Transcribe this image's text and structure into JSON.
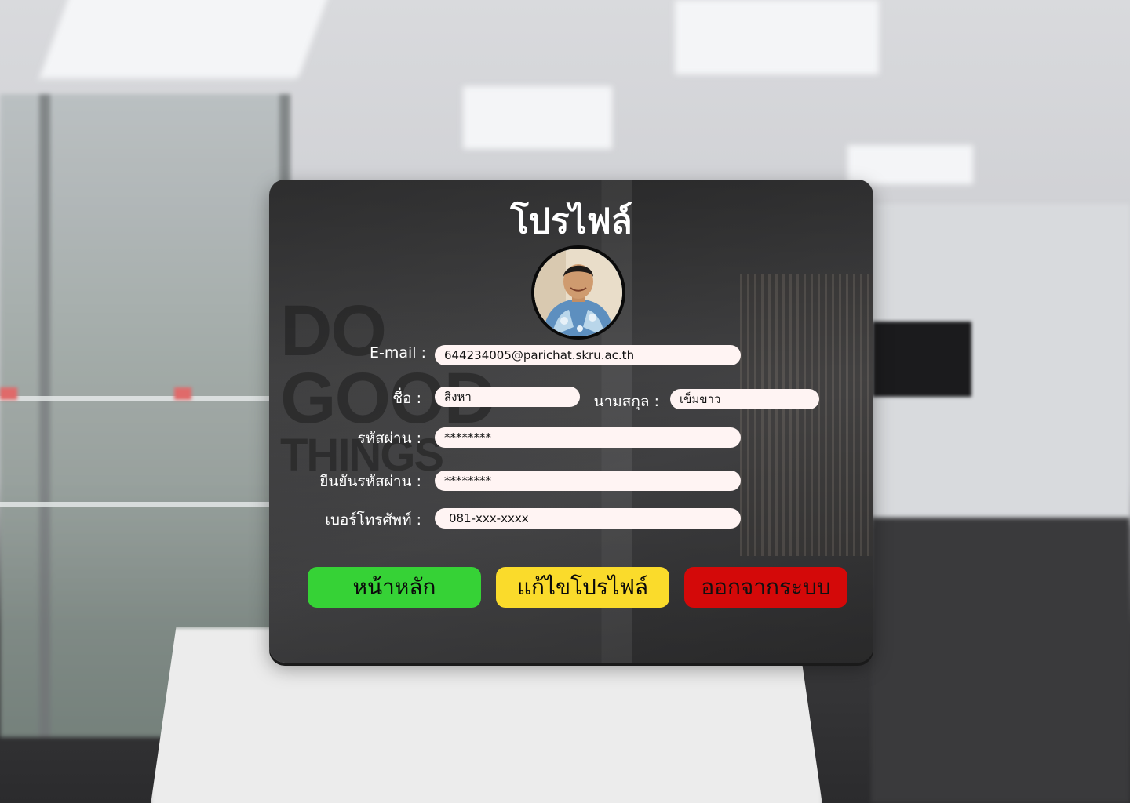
{
  "page": {
    "title": "โปรไฟล์"
  },
  "form": {
    "email_label": "E-mail :",
    "email_value": "644234005@parichat.skru.ac.th",
    "first_name_label": "ชื่อ :",
    "first_name_value": "สิงหา",
    "last_name_label": "นามสกุล :",
    "last_name_value": "เข็มขาว",
    "password_label": "รหัสผ่าน :",
    "password_value": "********",
    "confirm_password_label": "ยืนยันรหัสผ่าน :",
    "confirm_password_value": "********",
    "phone_label": "เบอร์โทรศัพท์ :",
    "phone_value": "081-xxx-xxxx"
  },
  "buttons": {
    "home": "หน้าหลัก",
    "edit_profile": "แก้ไขโปรไฟล์",
    "logout": "ออกจากระบบ"
  },
  "decor": {
    "wall_text_line1": "DO",
    "wall_text_line2": "GOOD",
    "wall_text_line3": "THINGS"
  },
  "colors": {
    "home_button": "#36d236",
    "edit_button": "#fadb2b",
    "logout_button": "#d40909",
    "field_background": "#fff4f3",
    "card_background": "#3a3a3b"
  },
  "icons": {
    "avatar": "user-avatar-photo"
  }
}
